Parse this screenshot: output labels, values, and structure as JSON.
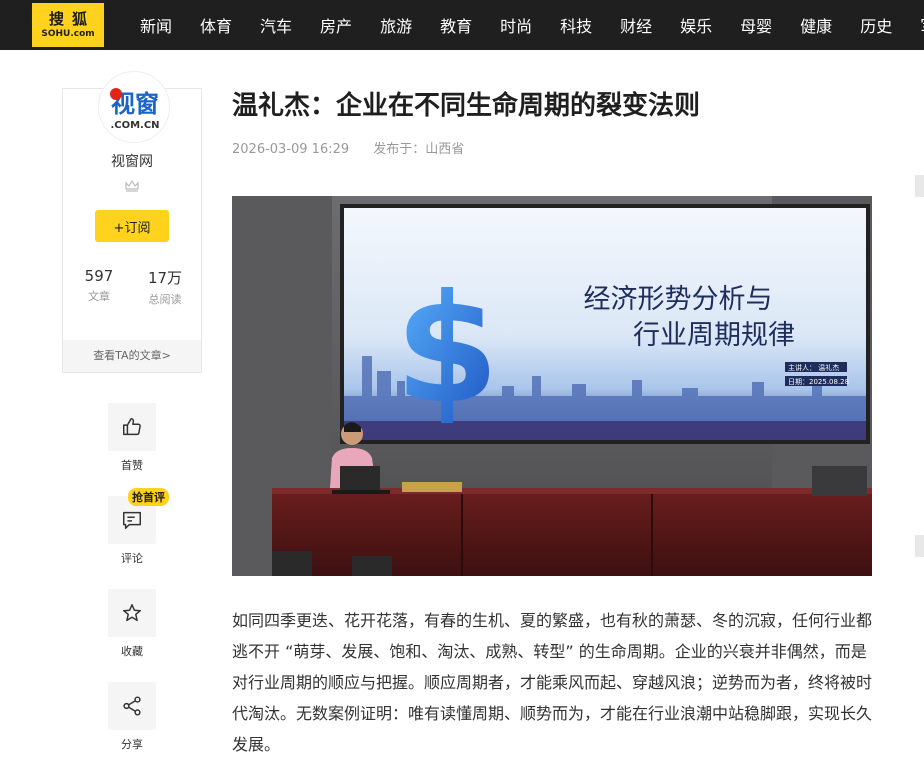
{
  "header": {
    "logo_top": "搜狐",
    "logo_bottom": "SOHU.com",
    "nav_items": [
      "新闻",
      "体育",
      "汽车",
      "房产",
      "旅游",
      "教育",
      "时尚",
      "科技",
      "财经",
      "娱乐",
      "母婴",
      "健康",
      "历史",
      "军事"
    ]
  },
  "author": {
    "avatar_text": "视窗",
    "avatar_sub": ".COM.CN",
    "name": "视窗网",
    "subscribe_label": "+订阅",
    "articles_count": "597",
    "articles_label": "文章",
    "reads_count": "17万",
    "reads_label": "总阅读",
    "view_articles_label": "查看TA的文章>"
  },
  "actions": {
    "like_label": "首赞",
    "comment_label": "评论",
    "comment_badge": "抢首评",
    "favorite_label": "收藏",
    "share_label": "分享"
  },
  "article": {
    "title": "温礼杰：企业在不同生命周期的裂变法则",
    "date": "2026-03-09 16:29",
    "published_at": "发布于：山西省",
    "paragraph": "如同四季更迭、花开花落，有春的生机、夏的繁盛，也有秋的萧瑟、冬的沉寂，任何行业都逃不开 “萌芽、发展、饱和、淘汰、成熟、转型” 的生命周期。企业的兴衰并非偶然，而是对行业周期的顺应与把握。顺应周期者，才能乘风而起、穿越风浪；逆势而为者，终将被时代淘汰。无数案例证明：唯有读懂周期、顺势而为，才能在行业浪潮中站稳脚跟，实现长久发展。"
  },
  "photo": {
    "screen_title_line1": "经济形势分析与",
    "screen_title_line2": "行业周期规律",
    "screen_speaker": "主讲人： 温礼杰",
    "screen_date": "日期：2025.08.28"
  },
  "colors": {
    "brand_yellow": "#ffd21e",
    "nav_bg": "#1f1f1f"
  }
}
